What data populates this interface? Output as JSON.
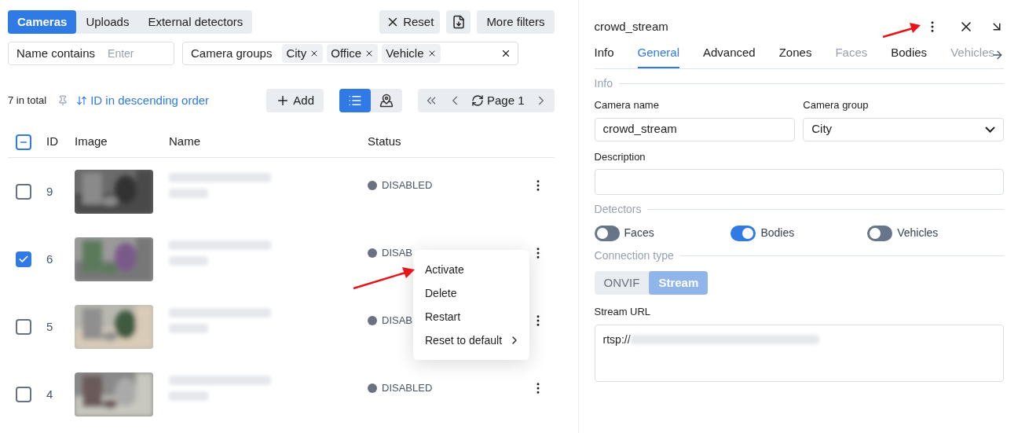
{
  "view_tabs": [
    {
      "label": "Cameras",
      "selected": true
    },
    {
      "label": "Uploads",
      "selected": false
    },
    {
      "label": "External detectors",
      "selected": false
    }
  ],
  "toolbar": {
    "reset": "Reset",
    "more_filters": "More filters"
  },
  "filters": {
    "name_label": "Name contains",
    "name_placeholder": "Enter",
    "groups_label": "Camera groups",
    "groups": [
      "City",
      "Office",
      "Vehicle"
    ]
  },
  "list_bar": {
    "total": "7 in total",
    "sort": "ID in descending order",
    "add": "Add",
    "view_modes": [
      {
        "kind": "list",
        "selected": true
      },
      {
        "kind": "map",
        "selected": false
      }
    ],
    "page": "Page 1"
  },
  "table": {
    "header_partial": true,
    "columns": [
      "ID",
      "Image",
      "Name",
      "Status"
    ],
    "rows": [
      {
        "checked": false,
        "id": "9",
        "status": "DISABLED"
      },
      {
        "checked": true,
        "id": "6",
        "status": "DISAB"
      },
      {
        "checked": false,
        "id": "5",
        "status": "DISAB"
      },
      {
        "checked": false,
        "id": "4",
        "status": "DISABLED"
      }
    ]
  },
  "context_menu": {
    "items": [
      {
        "label": "Activate",
        "submenu": false
      },
      {
        "label": "Delete",
        "submenu": false
      },
      {
        "label": "Restart",
        "submenu": false
      },
      {
        "label": "Reset to default",
        "submenu": true
      }
    ]
  },
  "panel": {
    "title": "crowd_stream",
    "tabs": [
      {
        "label": "Info",
        "selected": false,
        "disabled": false
      },
      {
        "label": "General",
        "selected": true,
        "disabled": false
      },
      {
        "label": "Advanced",
        "selected": false,
        "disabled": false
      },
      {
        "label": "Zones",
        "selected": false,
        "disabled": false
      },
      {
        "label": "Faces",
        "selected": false,
        "disabled": true
      },
      {
        "label": "Bodies",
        "selected": false,
        "disabled": false
      },
      {
        "label": "Vehicles",
        "selected": false,
        "disabled": true
      }
    ],
    "info_section": "Info",
    "camera_name_label": "Camera name",
    "camera_name": "crowd_stream",
    "camera_group_label": "Camera group",
    "camera_group": "City",
    "description_label": "Description",
    "detectors_section": "Detectors",
    "detectors": [
      {
        "label": "Faces",
        "on": false
      },
      {
        "label": "Bodies",
        "on": true
      },
      {
        "label": "Vehicles",
        "on": false
      }
    ],
    "connection_section": "Connection type",
    "connection_types": [
      {
        "label": "ONVIF",
        "selected": false
      },
      {
        "label": "Stream",
        "selected": true
      }
    ],
    "stream_url_label": "Stream URL",
    "stream_url": "rtsp://"
  }
}
